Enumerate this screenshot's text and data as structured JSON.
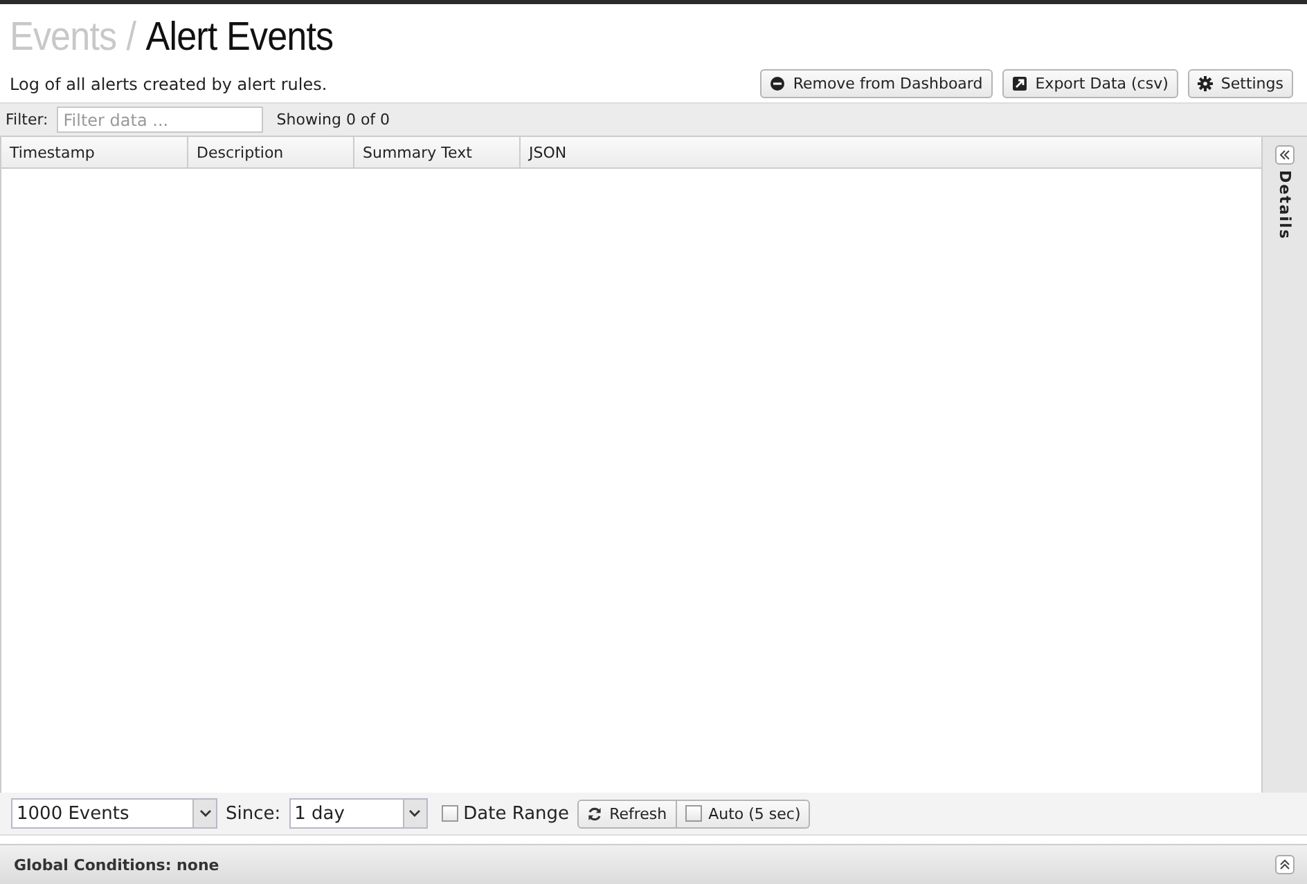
{
  "breadcrumb": {
    "parent": "Events",
    "separator": "/",
    "current": "Alert Events"
  },
  "description": "Log of all alerts created by alert rules.",
  "actions": [
    {
      "kind": "remove",
      "label": "Remove from Dashboard"
    },
    {
      "kind": "export",
      "label": "Export Data (csv)"
    },
    {
      "kind": "settings",
      "label": "Settings"
    }
  ],
  "filter": {
    "label": "Filter:",
    "placeholder": "Filter data ...",
    "count": "Showing 0 of 0"
  },
  "table": {
    "columns": [
      "Timestamp",
      "Description",
      "Summary Text",
      "JSON"
    ]
  },
  "details": {
    "label": "Details"
  },
  "toolbar": {
    "limit": "1000 Events",
    "since_label": "Since:",
    "since": "1 day",
    "date_range": {
      "label": "Date Range",
      "checked": false
    },
    "refresh": "Refresh",
    "auto": {
      "label": "Auto (5 sec)",
      "checked": false
    }
  },
  "global_conditions": "Global Conditions: none"
}
